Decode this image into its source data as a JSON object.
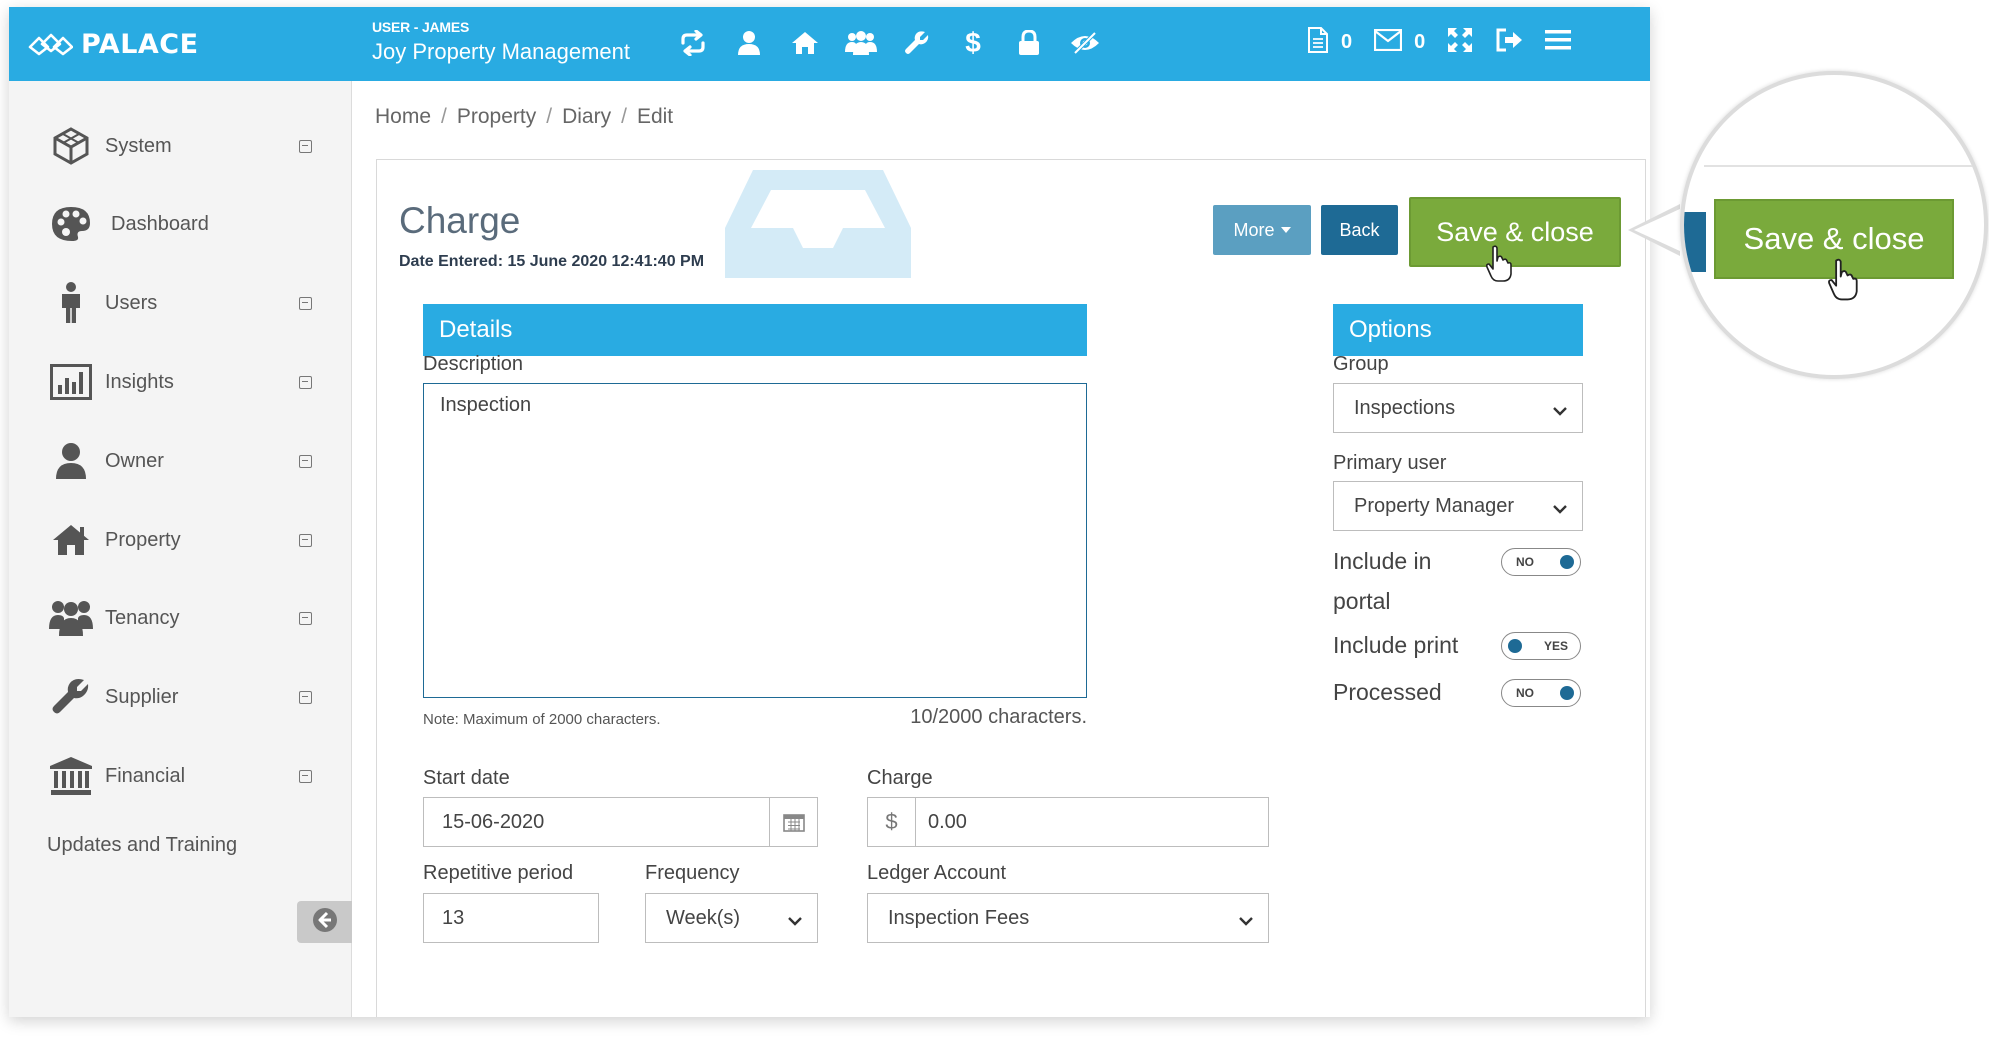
{
  "header": {
    "brand": "PALACE",
    "user_label": "USER - JAMES",
    "company": "Joy Property Management",
    "icons": [
      "sync-icon",
      "user-icon",
      "home-icon",
      "group-icon",
      "wrench-icon",
      "dollar-icon",
      "lock-icon",
      "eye-slash-icon"
    ],
    "dollar_glyph": "$",
    "documents_count": "0",
    "messages_count": "0"
  },
  "sidebar": {
    "items": [
      {
        "label": "System",
        "icon": "cube-icon"
      },
      {
        "label": "Dashboard",
        "icon": "palette-icon"
      },
      {
        "label": "Users",
        "icon": "person-icon"
      },
      {
        "label": "Insights",
        "icon": "bar-chart-icon"
      },
      {
        "label": "Owner",
        "icon": "user-icon"
      },
      {
        "label": "Property",
        "icon": "home-icon"
      },
      {
        "label": "Tenancy",
        "icon": "group-icon"
      },
      {
        "label": "Supplier",
        "icon": "wrench-icon"
      },
      {
        "label": "Financial",
        "icon": "bank-icon"
      }
    ],
    "updates_label": "Updates and Training"
  },
  "breadcrumb": [
    "Home",
    "Property",
    "Diary",
    "Edit"
  ],
  "page": {
    "title": "Charge",
    "date_entered": "Date Entered: 15 June 2020 12:41:40 PM"
  },
  "buttons": {
    "more": "More",
    "back": "Back",
    "save_close": "Save & close"
  },
  "details": {
    "heading": "Details",
    "description_label": "Description",
    "description_value": "Inspection",
    "note": "Note: Maximum of 2000 characters.",
    "char_count": "10/2000 characters.",
    "start_date_label": "Start date",
    "start_date_value": "15-06-2020",
    "charge_label": "Charge",
    "currency_symbol": "$",
    "charge_value": "0.00",
    "repetitive_label": "Repetitive period",
    "repetitive_value": "13",
    "frequency_label": "Frequency",
    "frequency_value": "Week(s)",
    "ledger_label": "Ledger Account",
    "ledger_value": "Inspection Fees"
  },
  "options": {
    "heading": "Options",
    "group_label": "Group",
    "group_value": "Inspections",
    "primary_user_label": "Primary user",
    "primary_user_value": "Property Manager",
    "include_portal_label_1": "Include in",
    "include_portal_label_2": "portal",
    "include_portal_state": "NO",
    "include_print_label": "Include print",
    "include_print_state": "YES",
    "processed_label": "Processed",
    "processed_state": "NO"
  },
  "magnifier": {
    "save_close": "Save & close"
  },
  "colors": {
    "header_blue": "#29abe2",
    "dark_blue": "#1e6a95",
    "more_blue": "#5b9fc1",
    "save_green": "#7aaa3c"
  }
}
